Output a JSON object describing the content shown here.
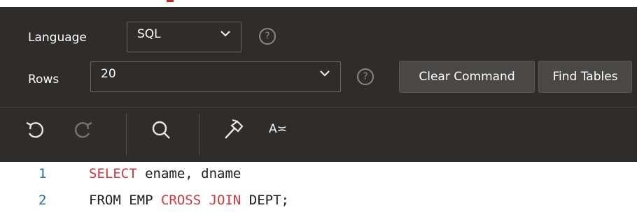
{
  "toolbar": {
    "language_label": "Language",
    "language_value": "SQL",
    "rows_label": "Rows",
    "rows_value": "20",
    "help_glyph": "?",
    "clear_command_label": "Clear Command",
    "find_tables_label": "Find Tables"
  },
  "editor_tools": {
    "undo_icon": "undo-icon",
    "redo_icon": "redo-icon",
    "find_icon": "search-icon",
    "build_icon": "hammer-icon",
    "format_label": "A≍"
  },
  "editor": {
    "lines": [
      {
        "number": "1",
        "tokens": [
          {
            "text": "SELECT",
            "kw": true
          },
          {
            "text": " ename, dname",
            "kw": false
          }
        ]
      },
      {
        "number": "2",
        "tokens": [
          {
            "text": "FROM",
            "kw": false
          },
          {
            "text": " EMP ",
            "kw": false
          },
          {
            "text": "CROSS JOIN",
            "kw": true
          },
          {
            "text": " DEPT;",
            "kw": false
          }
        ]
      }
    ]
  },
  "colors": {
    "panel": "#2f2d2b",
    "keyword": "#c9393d",
    "line_number": "#1f6f9f",
    "button": "#4a4846"
  }
}
